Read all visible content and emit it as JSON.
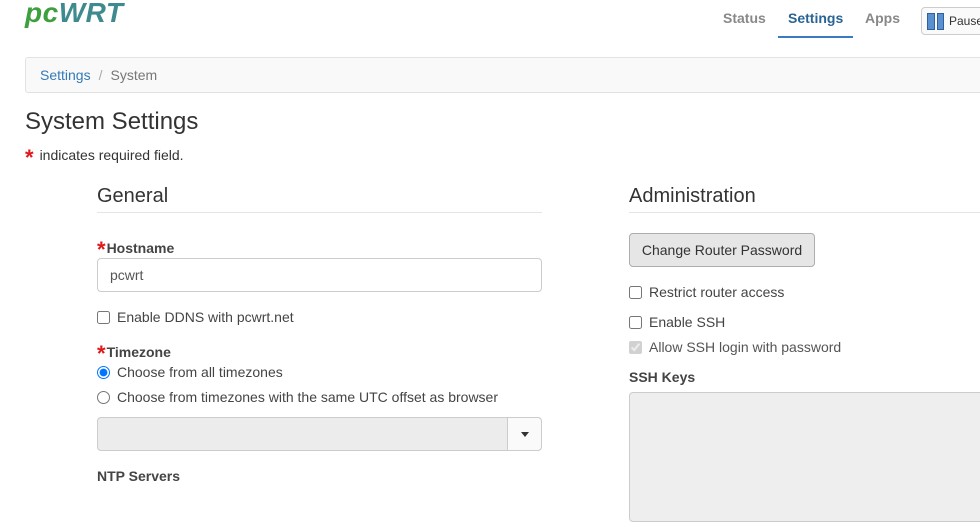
{
  "header": {
    "logo_pc": "pc",
    "logo_wrt": "WRT",
    "nav": [
      {
        "label": "Status"
      },
      {
        "label": "Settings"
      },
      {
        "label": "Apps"
      }
    ],
    "pause_label": "Pause"
  },
  "breadcrumb": {
    "root": "Settings",
    "separator": "/",
    "current": "System"
  },
  "page": {
    "title": "System Settings",
    "required_star": "*",
    "required_note": "indicates required field."
  },
  "general": {
    "title": "General",
    "hostname_label": "Hostname",
    "hostname_value": "pcwrt",
    "ddns_label": "Enable DDNS with pcwrt.net",
    "ddns_checked": false,
    "timezone_label": "Timezone",
    "tz_option_all": "Choose from all timezones",
    "tz_option_utc": "Choose from timezones with the same UTC offset as browser",
    "tz_selected": "all",
    "timezone_select_value": "",
    "ntp_label": "NTP Servers"
  },
  "administration": {
    "title": "Administration",
    "change_password_label": "Change Router Password",
    "restrict_label": "Restrict router access",
    "restrict_checked": false,
    "ssh_label": "Enable SSH",
    "ssh_checked": false,
    "ssh_password_label": "Allow SSH login with password",
    "ssh_password_checked": true,
    "ssh_keys_label": "SSH Keys",
    "ssh_keys_value": ""
  },
  "colors": {
    "accent": "#337ab7",
    "required": "#e0181a",
    "logo_green": "#3e9f3e",
    "logo_teal": "#3f8a8f"
  }
}
